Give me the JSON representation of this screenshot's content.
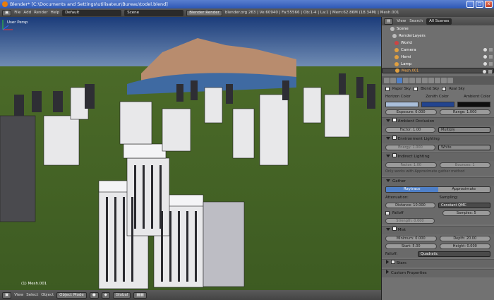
{
  "window": {
    "title": "Blender* [C:\\Documents and Settings\\utilisateur\\Bureau\\todel.blend]",
    "minimize": "_",
    "maximize": "□",
    "close": "x"
  },
  "topbar": {
    "menus": [
      "File",
      "Add",
      "Render",
      "Help"
    ],
    "layout": "Default",
    "scene": "Scene",
    "engine": "Blender Render",
    "stats": "blender.org 263 | Ve:60940 | Fa:55566 | Ob:1-4 | La:1 | Mem:62.86M (18.34M) | Mesh.001"
  },
  "viewport": {
    "label": "User Persp",
    "object_info": "(1) Mesh.001"
  },
  "bottombar": {
    "menus": [
      "View",
      "Select",
      "Object"
    ],
    "mode": "Object Mode",
    "orientation": "Global"
  },
  "outliner": {
    "header": {
      "menus": [
        "View",
        "Search"
      ],
      "filter": "All Scenes"
    },
    "items": [
      {
        "label": "Scene",
        "color": "#bbbbbb"
      },
      {
        "label": "RenderLayers",
        "color": "#bbbbbb"
      },
      {
        "label": "World",
        "color": "#cc4444"
      },
      {
        "label": "Camera",
        "color": "#e0a040"
      },
      {
        "label": "Hemi",
        "color": "#e0a040"
      },
      {
        "label": "Lamp",
        "color": "#e0a040"
      },
      {
        "label": "Mesh.001",
        "color": "#e0a040"
      }
    ]
  },
  "props": {
    "paper_sky": "Paper Sky",
    "blend_sky": "Blend Sky",
    "real_sky": "Real Sky",
    "horizon": "Horizon Color",
    "zenith": "Zenith Color",
    "ambient": "Ambient Color",
    "colors": {
      "horizon": "#aabfdb",
      "zenith": "#22448f",
      "ambient": "#0e0e0e"
    },
    "exposure": "Exposure: 0.000",
    "range": "Range: 1.000",
    "ao": {
      "title": "Ambient Occlusion",
      "factor": "Factor: 1.00",
      "mode": "Multiply"
    },
    "env": {
      "title": "Environment Lighting",
      "energy": "Energy: 1.000",
      "color": "White"
    },
    "indirect": {
      "title": "Indirect Lighting",
      "factor": "Factor: 1.00",
      "bounces": "Bounces: 1",
      "note": "Only works with Approximate gather method"
    },
    "gather": {
      "title": "Gather",
      "raytrace": "Raytrace",
      "approximate": "Approximate",
      "attenuation": "Attenuation:",
      "sampling": "Sampling:",
      "distance": "Distance: 10.000",
      "qmc": "Constant QMC",
      "falloff": "Falloff",
      "samples": "Samples: 5",
      "strength": "Strength: 0.000"
    },
    "mist": {
      "title": "Mist",
      "minimum": "Minimum: 0.000",
      "depth": "Depth: 20.00",
      "start": "Start: 5.00",
      "height": "Height: 0.000",
      "falloff_label": "Falloff:",
      "falloff": "Quadratic"
    },
    "stars": "Stars",
    "custom": "Custom Properties"
  }
}
